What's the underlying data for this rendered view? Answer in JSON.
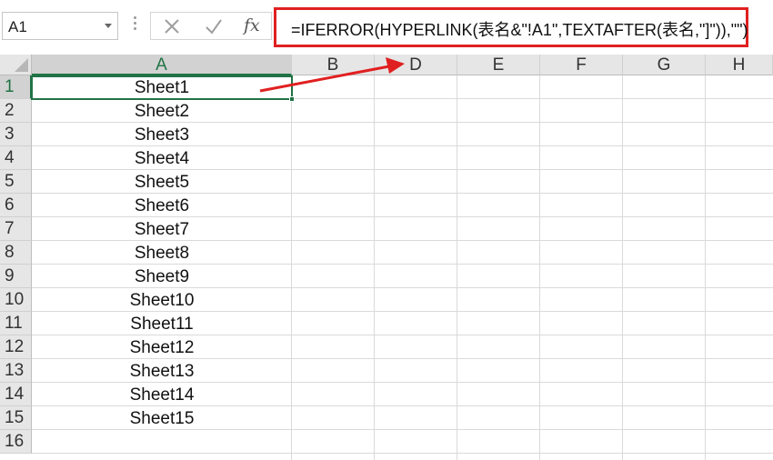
{
  "name_box": {
    "value": "A1"
  },
  "formula_bar": {
    "formula": "=IFERROR(HYPERLINK(表名&\"!A1\",TEXTAFTER(表名,\"]\")),\"\")"
  },
  "grid": {
    "columns": [
      "A",
      "B",
      "D",
      "E",
      "F",
      "G",
      "H"
    ],
    "rows": [
      "1",
      "2",
      "3",
      "4",
      "5",
      "6",
      "7",
      "8",
      "9",
      "10",
      "11",
      "12",
      "13",
      "14",
      "15",
      "16"
    ],
    "column_a_values": [
      "Sheet1",
      "Sheet2",
      "Sheet3",
      "Sheet4",
      "Sheet5",
      "Sheet6",
      "Sheet7",
      "Sheet8",
      "Sheet9",
      "Sheet10",
      "Sheet11",
      "Sheet12",
      "Sheet13",
      "Sheet14",
      "Sheet15",
      ""
    ],
    "selected_cell": "A1"
  },
  "annotations": {
    "highlight_color": "#e02020",
    "accent_color": "#217346"
  }
}
